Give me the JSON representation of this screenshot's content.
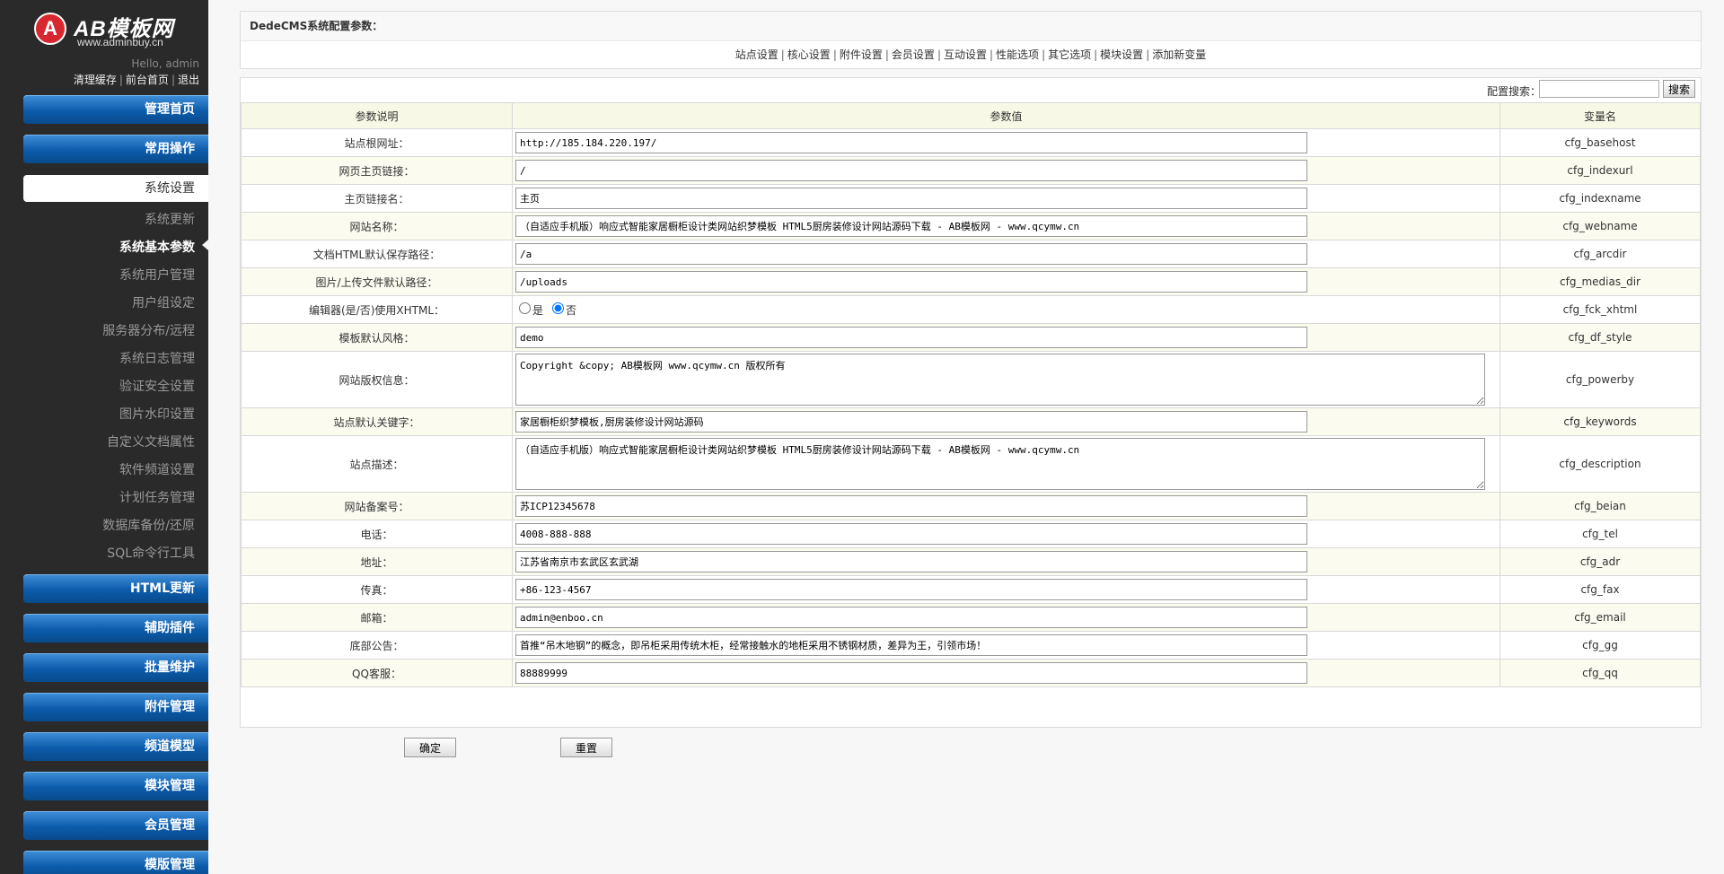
{
  "sidebar": {
    "logo_letter": "A",
    "logo_title": "AB模板网",
    "logo_url": "www.adminbuy.cn",
    "hello": "Hello, admin",
    "links": [
      "清理缓存",
      "前台首页",
      "退出"
    ],
    "top_menus": [
      "管理首页",
      "常用操作"
    ],
    "active_menu": "系统设置",
    "sub_items": [
      "系统更新",
      "系统基本参数",
      "系统用户管理",
      "用户组设定",
      "服务器分布/远程",
      "系统日志管理",
      "验证安全设置",
      "图片水印设置",
      "自定义文档属性",
      "软件频道设置",
      "计划任务管理",
      "数据库备份/还原",
      "SQL命令行工具"
    ],
    "bottom_menus": [
      "HTML更新",
      "辅助插件",
      "批量维护",
      "附件管理",
      "频道模型",
      "模块管理",
      "会员管理",
      "模版管理"
    ]
  },
  "header": {
    "title": "DedeCMS系统配置参数：",
    "tabs": [
      "站点设置",
      "核心设置",
      "附件设置",
      "会员设置",
      "互动设置",
      "性能选项",
      "其它选项",
      "模块设置",
      "添加新变量"
    ]
  },
  "search": {
    "label": "配置搜索：",
    "value": "",
    "button": "搜索"
  },
  "table": {
    "headers": [
      "参数说明",
      "参数值",
      "变量名"
    ],
    "rows": [
      {
        "label": "站点根网址：",
        "value": "http://185.184.220.197/",
        "var": "cfg_basehost"
      },
      {
        "label": "网页主页链接：",
        "value": "/",
        "var": "cfg_indexurl"
      },
      {
        "label": "主页链接名：",
        "value": "主页",
        "var": "cfg_indexname"
      },
      {
        "label": "网站名称：",
        "value": "（自适应手机版）响应式智能家居橱柜设计类网站织梦模板 HTML5厨房装修设计网站源码下载 - AB模板网 - www.qcymw.cn",
        "var": "cfg_webname"
      },
      {
        "label": "文档HTML默认保存路径：",
        "value": "/a",
        "var": "cfg_arcdir"
      },
      {
        "label": "图片/上传文件默认路径：",
        "value": "/uploads",
        "var": "cfg_medias_dir"
      },
      {
        "label": "编辑器(是/否)使用XHTML：",
        "radio": [
          "是",
          "否"
        ],
        "selected": "否",
        "var": "cfg_fck_xhtml"
      },
      {
        "label": "模板默认风格：",
        "value": "demo",
        "var": "cfg_df_style"
      },
      {
        "label": "网站版权信息：",
        "value": "Copyright &copy; AB模板网 www.qcymw.cn 版权所有",
        "var": "cfg_powerby",
        "textarea": true
      },
      {
        "label": "站点默认关键字：",
        "value": "家居橱柜织梦模板,厨房装修设计网站源码",
        "var": "cfg_keywords"
      },
      {
        "label": "站点描述：",
        "value": "（自适应手机版）响应式智能家居橱柜设计类网站织梦模板 HTML5厨房装修设计网站源码下载 - AB模板网 - www.qcymw.cn",
        "var": "cfg_description",
        "textarea": true
      },
      {
        "label": "网站备案号：",
        "value": "苏ICP12345678",
        "var": "cfg_beian"
      },
      {
        "label": "电话：",
        "value": "4008-888-888",
        "var": "cfg_tel"
      },
      {
        "label": "地址：",
        "value": "江苏省南京市玄武区玄武湖",
        "var": "cfg_adr"
      },
      {
        "label": "传真：",
        "value": "+86-123-4567",
        "var": "cfg_fax"
      },
      {
        "label": "邮箱：",
        "value": "admin@enboo.cn",
        "var": "cfg_email"
      },
      {
        "label": "底部公告：",
        "value": "首推“吊木地钢”的概念，即吊柜采用传统木柜，经常接触水的地柜采用不锈钢材质，差异为王，引领市场！",
        "var": "cfg_gg"
      },
      {
        "label": "QQ客服：",
        "value": "88889999",
        "var": "cfg_qq"
      }
    ]
  },
  "buttons": {
    "confirm": "确定",
    "reset": "重置"
  }
}
